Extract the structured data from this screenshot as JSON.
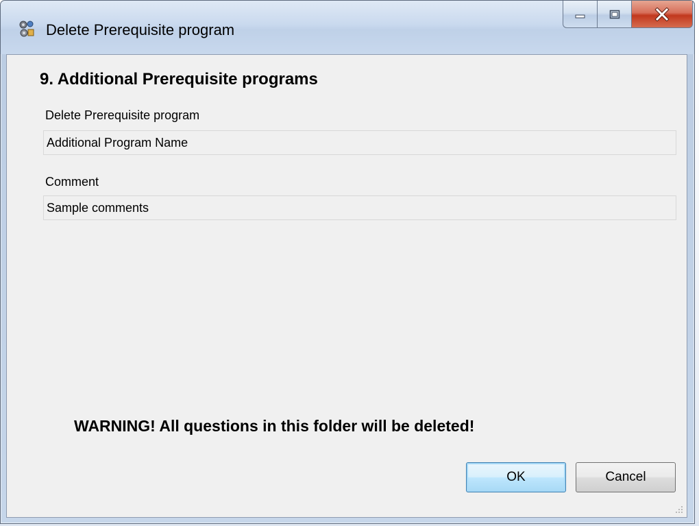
{
  "window": {
    "title": "Delete Prerequisite program"
  },
  "dialog": {
    "heading": "9. Additional Prerequisite programs",
    "program_label": "Delete Prerequisite program",
    "program_value": "Additional Program Name",
    "comment_label": "Comment",
    "comment_value": "Sample comments",
    "warning": "WARNING!  All questions in this folder will be deleted!"
  },
  "buttons": {
    "ok": "OK",
    "cancel": "Cancel"
  },
  "icons": {
    "app": "app-icon",
    "minimize": "minimize-icon",
    "maximize": "maximize-icon",
    "close": "close-icon",
    "resize": "resize-grip-icon"
  },
  "colors": {
    "close_button": "#c2381e",
    "default_button_border": "#3c7fb1",
    "client_background": "#f0f0f0"
  }
}
